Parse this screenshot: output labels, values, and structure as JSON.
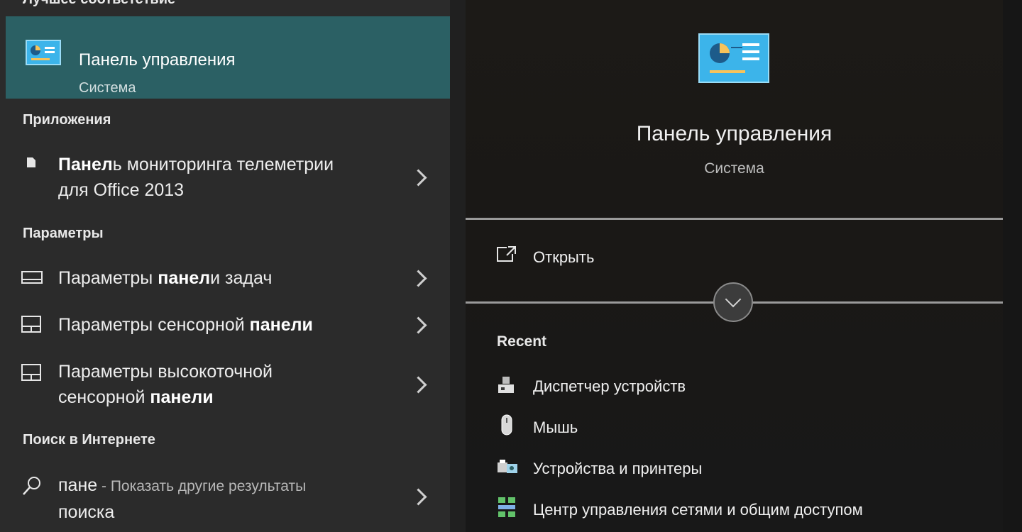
{
  "left": {
    "best_header": "Лучшее соответствие",
    "best_match": {
      "title_bold": "Панел",
      "title_rest": "ь управления",
      "subtitle": "Система",
      "icon": "control-panel-icon"
    },
    "sections": {
      "apps": "Приложения",
      "settings": "Параметры",
      "web": "Поиск в Интернете"
    },
    "apps": [
      {
        "bold": "Панел",
        "rest": "ь мониторинга телеметрии",
        "line2": "для Office 2013",
        "icon": "document-icon"
      }
    ],
    "settings": [
      {
        "pre": "Параметры ",
        "bold": "панел",
        "post": "и задач",
        "line2": "",
        "icon": "taskbar-icon"
      },
      {
        "pre": "Параметры сенсорной ",
        "bold": "панели",
        "post": "",
        "line2": "",
        "icon": "touchpad-icon"
      },
      {
        "pre": "Параметры высокоточной",
        "bold": "",
        "post": "",
        "line2_pre": "сенсорной ",
        "line2_bold": "панели",
        "icon": "touchpad-icon"
      }
    ],
    "web": {
      "query": "пане",
      "suffix": " - Показать другие результаты",
      "line2": "поиска",
      "icon": "search-icon"
    }
  },
  "right": {
    "title": "Панель управления",
    "subtitle": "Система",
    "open_label": "Открыть",
    "recent_header": "Recent",
    "recent": [
      {
        "label": "Диспетчер устройств",
        "icon": "device-manager-icon"
      },
      {
        "label": "Мышь",
        "icon": "mouse-icon"
      },
      {
        "label": "Устройства и принтеры",
        "icon": "printer-icon"
      },
      {
        "label": "Центр управления сетями и общим доступом",
        "icon": "network-icon"
      }
    ]
  },
  "colors": {
    "accent": "#2b6064",
    "panel": "#2b2b2b",
    "preview": "#1c1a17"
  }
}
